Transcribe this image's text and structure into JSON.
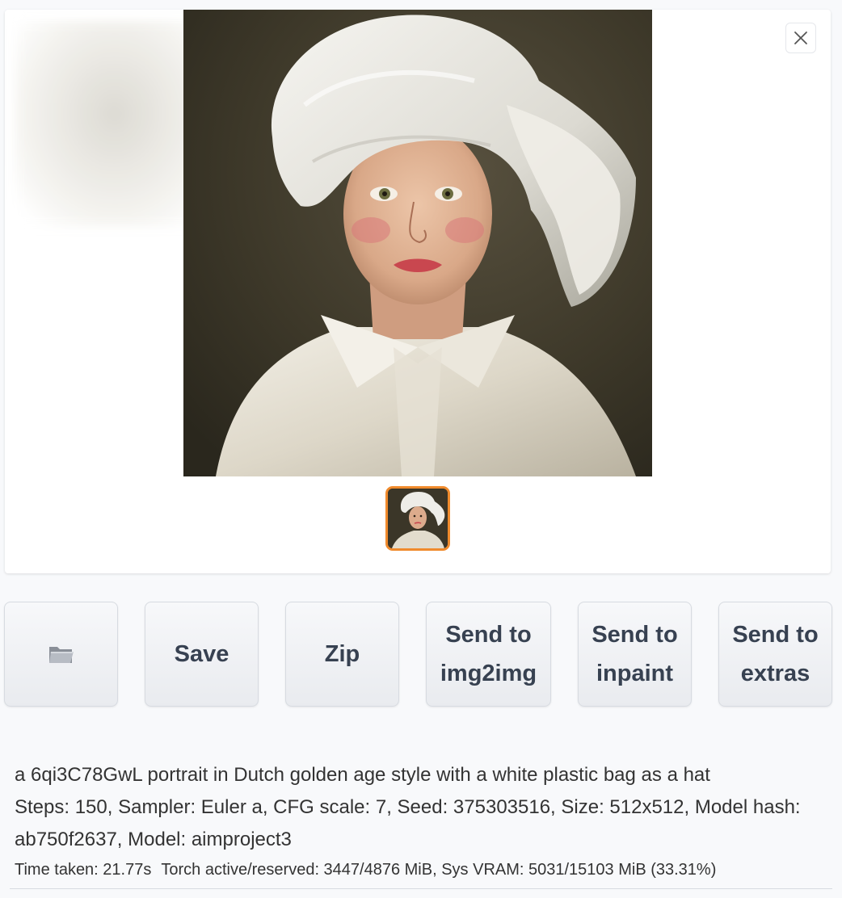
{
  "gallery": {
    "main_image": {
      "alt": "portrait"
    },
    "close_icon": "close-icon",
    "thumbnails": [
      {
        "selected": true,
        "accent": "#f08a2c"
      }
    ]
  },
  "buttons": [
    {
      "id": "open-folder",
      "icon": "folder-icon",
      "label": ""
    },
    {
      "id": "save",
      "label": "Save"
    },
    {
      "id": "zip",
      "label": "Zip"
    },
    {
      "id": "send-img2img",
      "label": "Send to\nimg2img"
    },
    {
      "id": "send-inpaint",
      "label": "Send to\ninpaint"
    },
    {
      "id": "send-extras",
      "label": "Send to\nextras"
    }
  ],
  "generation_info": {
    "prompt": "a 6qi3C78GwL portrait in Dutch golden age style with a white plastic bag as a hat",
    "params": "Steps: 150, Sampler: Euler a, CFG scale: 7, Seed: 375303516, Size: 512x512, Model hash: ab750f2637, Model: aimproject3"
  },
  "stats": {
    "time_taken": "Time taken: 21.77s",
    "memory": "Torch active/reserved: 3447/4876 MiB, Sys VRAM: 5031/15103 MiB (33.31%)"
  }
}
